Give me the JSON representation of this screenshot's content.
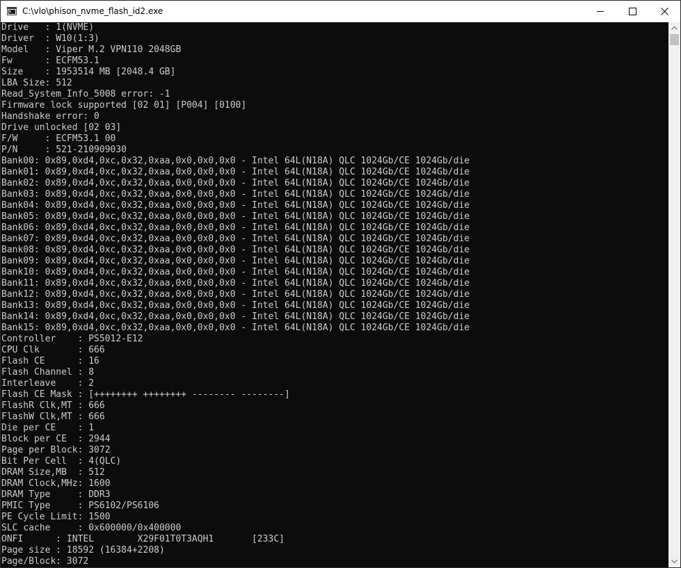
{
  "window": {
    "title": "C:\\vlo\\phison_nvme_flash_id2.exe",
    "colors": {
      "console_bg": "#0c0c0c",
      "console_fg": "#cccccc",
      "titlebar_bg": "#ffffff"
    }
  },
  "titlebar_icons": {
    "app": "console-app-icon",
    "minimize": "minimize-icon",
    "maximize": "maximize-icon",
    "close": "close-icon"
  },
  "console": {
    "lines": [
      "Drive   : 1(NVME)",
      "Driver  : W10(1:3)",
      "Model   : Viper M.2 VPN110 2048GB",
      "Fw      : ECFM53.1",
      "Size    : 1953514 MB [2048.4 GB]",
      "LBA Size: 512",
      "Read_System_Info_5008 error: -1",
      "Firmware lock supported [02 01] [P004] [0100]",
      "Handshake error: 0",
      "Drive unlocked [02 03]",
      "F/W     : ECFM53.1 00",
      "P/N     : 521-210909030",
      "Bank00: 0x89,0xd4,0xc,0x32,0xaa,0x0,0x0,0x0 - Intel 64L(N18A) QLC 1024Gb/CE 1024Gb/die",
      "Bank01: 0x89,0xd4,0xc,0x32,0xaa,0x0,0x0,0x0 - Intel 64L(N18A) QLC 1024Gb/CE 1024Gb/die",
      "Bank02: 0x89,0xd4,0xc,0x32,0xaa,0x0,0x0,0x0 - Intel 64L(N18A) QLC 1024Gb/CE 1024Gb/die",
      "Bank03: 0x89,0xd4,0xc,0x32,0xaa,0x0,0x0,0x0 - Intel 64L(N18A) QLC 1024Gb/CE 1024Gb/die",
      "Bank04: 0x89,0xd4,0xc,0x32,0xaa,0x0,0x0,0x0 - Intel 64L(N18A) QLC 1024Gb/CE 1024Gb/die",
      "Bank05: 0x89,0xd4,0xc,0x32,0xaa,0x0,0x0,0x0 - Intel 64L(N18A) QLC 1024Gb/CE 1024Gb/die",
      "Bank06: 0x89,0xd4,0xc,0x32,0xaa,0x0,0x0,0x0 - Intel 64L(N18A) QLC 1024Gb/CE 1024Gb/die",
      "Bank07: 0x89,0xd4,0xc,0x32,0xaa,0x0,0x0,0x0 - Intel 64L(N18A) QLC 1024Gb/CE 1024Gb/die",
      "Bank08: 0x89,0xd4,0xc,0x32,0xaa,0x0,0x0,0x0 - Intel 64L(N18A) QLC 1024Gb/CE 1024Gb/die",
      "Bank09: 0x89,0xd4,0xc,0x32,0xaa,0x0,0x0,0x0 - Intel 64L(N18A) QLC 1024Gb/CE 1024Gb/die",
      "Bank10: 0x89,0xd4,0xc,0x32,0xaa,0x0,0x0,0x0 - Intel 64L(N18A) QLC 1024Gb/CE 1024Gb/die",
      "Bank11: 0x89,0xd4,0xc,0x32,0xaa,0x0,0x0,0x0 - Intel 64L(N18A) QLC 1024Gb/CE 1024Gb/die",
      "Bank12: 0x89,0xd4,0xc,0x32,0xaa,0x0,0x0,0x0 - Intel 64L(N18A) QLC 1024Gb/CE 1024Gb/die",
      "Bank13: 0x89,0xd4,0xc,0x32,0xaa,0x0,0x0,0x0 - Intel 64L(N18A) QLC 1024Gb/CE 1024Gb/die",
      "Bank14: 0x89,0xd4,0xc,0x32,0xaa,0x0,0x0,0x0 - Intel 64L(N18A) QLC 1024Gb/CE 1024Gb/die",
      "Bank15: 0x89,0xd4,0xc,0x32,0xaa,0x0,0x0,0x0 - Intel 64L(N18A) QLC 1024Gb/CE 1024Gb/die",
      "Controller    : PS5012-E12",
      "CPU Clk       : 666",
      "Flash CE      : 16",
      "Flash Channel : 8",
      "Interleave    : 2",
      "Flash CE Mask : [++++++++ ++++++++ -------- --------]",
      "FlashR Clk,MT : 666",
      "FlashW Clk,MT : 666",
      "Die per CE    : 1",
      "Block per CE  : 2944",
      "Page per Block: 3072",
      "Bit Per Cell  : 4(QLC)",
      "DRAM Size,MB  : 512",
      "DRAM Clock,MHz: 1600",
      "DRAM Type     : DDR3",
      "PMIC Type     : PS6102/PS6106",
      "PE Cycle Limit: 1500",
      "SLC cache     : 0x600000/0x400000",
      "ONFI      : INTEL        X29F01T0T3AQH1       [233C]",
      "Page size : 18592 (16384+2208)",
      "Page/Block: 3072"
    ]
  }
}
